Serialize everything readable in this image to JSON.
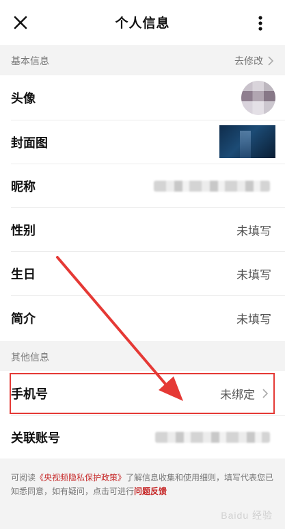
{
  "header": {
    "title": "个人信息",
    "close_icon": "close-icon",
    "more_icon": "more-vertical-icon"
  },
  "basic_section": {
    "label": "基本信息",
    "action_label": "去修改"
  },
  "basic_rows": [
    {
      "label": "头像",
      "value": ""
    },
    {
      "label": "封面图",
      "value": ""
    },
    {
      "label": "昵称",
      "value": ""
    },
    {
      "label": "性别",
      "value": "未填写"
    },
    {
      "label": "生日",
      "value": "未填写"
    },
    {
      "label": "简介",
      "value": "未填写"
    }
  ],
  "other_section": {
    "label": "其他信息"
  },
  "other_rows": [
    {
      "label": "手机号",
      "value": "未绑定"
    },
    {
      "label": "关联账号",
      "value": ""
    }
  ],
  "footer": {
    "text_prefix": "可阅读",
    "policy_link": "《央视频隐私保护政策》",
    "text_middle": "了解信息收集和使用细则，填写代表您已知悉同意，如有疑问，点击可进行",
    "feedback_link": "问题反馈"
  },
  "watermark": "Baidu 经验",
  "colors": {
    "accent_red": "#e53935",
    "link_red": "#c62828",
    "section_bg": "#f3f3f3"
  }
}
